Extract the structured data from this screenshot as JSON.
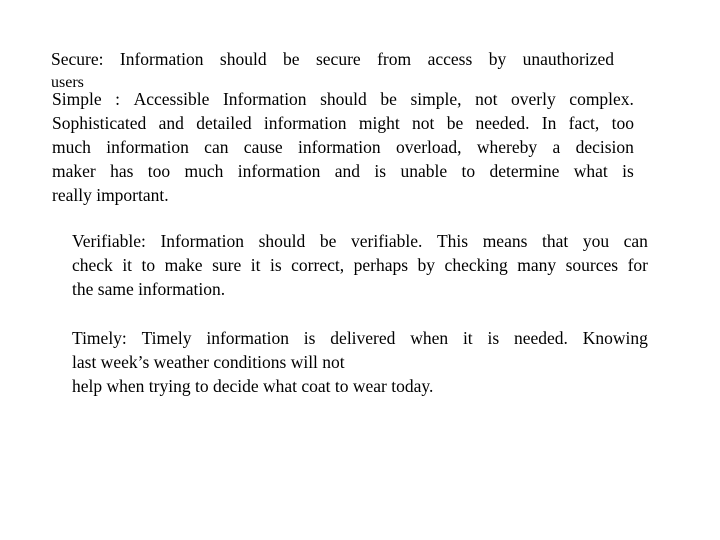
{
  "paragraphs": {
    "secure": {
      "lines": [
        "Secure: Information should be secure from access by unauthorized",
        "users"
      ]
    },
    "simple": {
      "lines": [
        "Simple : Accessible Information should be simple, not overly complex.",
        "Sophisticated and detailed information might not be needed. In fact, too",
        "much information can cause information overload, whereby a decision",
        "maker has too much information and is unable to determine what is",
        "really important."
      ]
    },
    "verifiable": {
      "lines": [
        "Verifiable: Information should be verifiable. This means that you can",
        "check it to make sure it is correct, perhaps by checking many sources for",
        "the same information."
      ]
    },
    "timely": {
      "lines": [
        "Timely: Timely information is delivered when it is needed. Knowing",
        "last week’s weather conditions will not",
        "help when trying to decide what coat to wear today."
      ]
    }
  }
}
